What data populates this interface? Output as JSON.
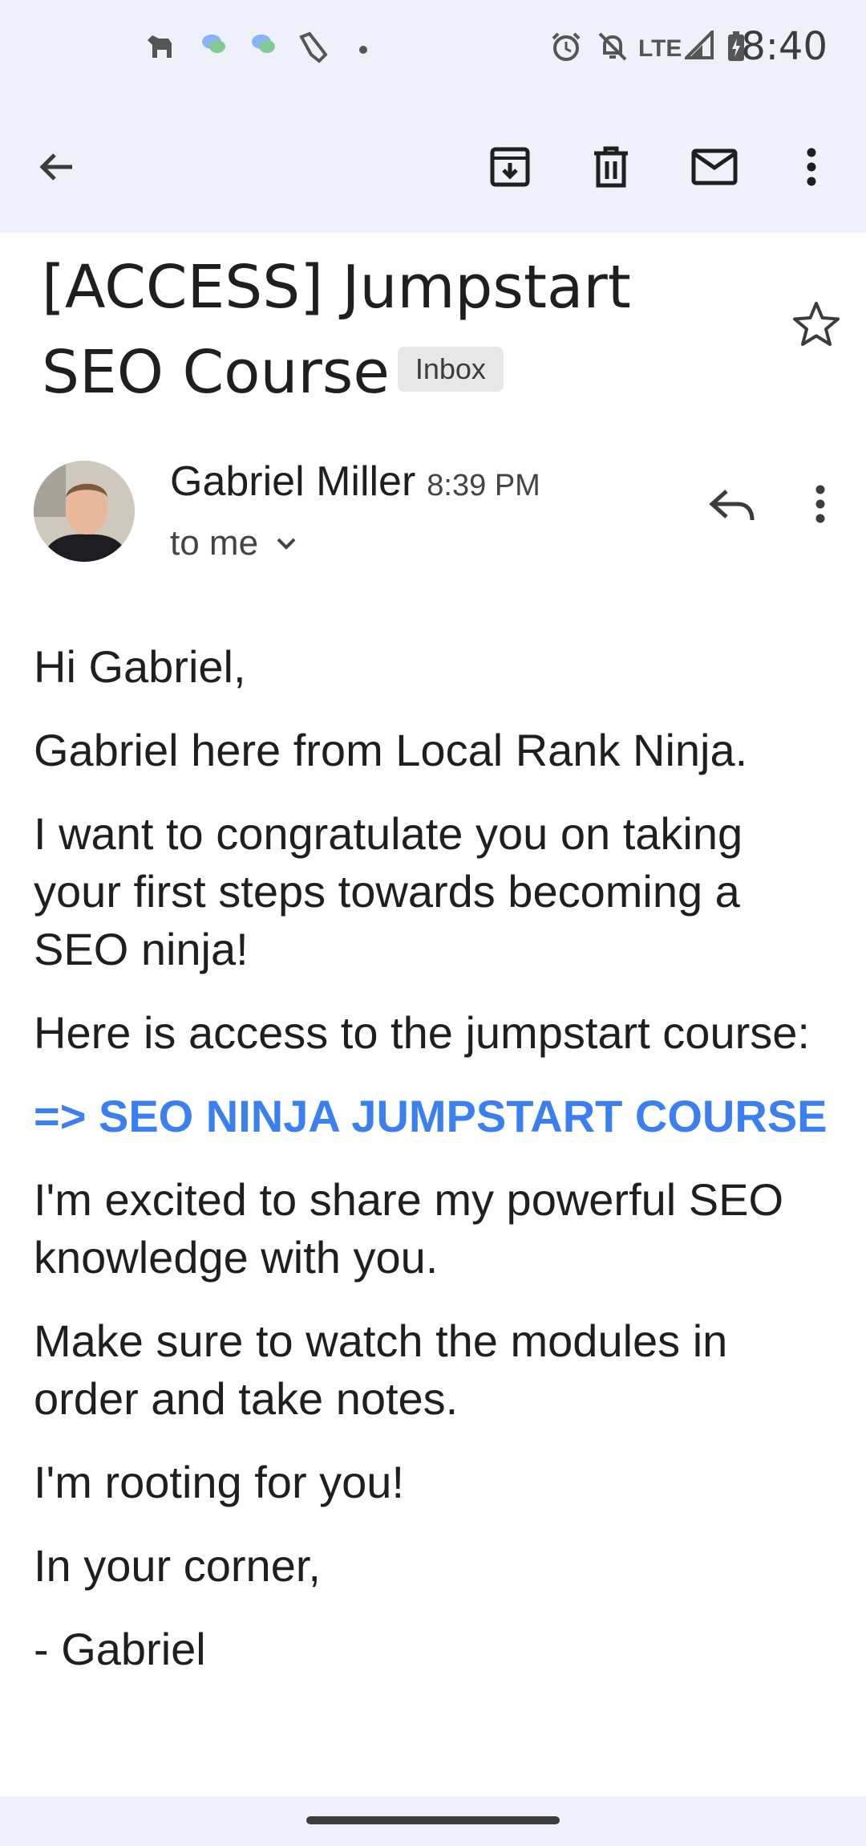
{
  "status_bar": {
    "time": "8:40",
    "network": "LTE",
    "icons": [
      "pets-icon",
      "chat-bubble-icon",
      "chat-bubble-icon",
      "broom-icon",
      "dot-icon",
      "alarm-icon",
      "bell-off-icon",
      "signal-icon",
      "battery-icon"
    ]
  },
  "app_bar": {
    "icons": [
      "back-arrow-icon",
      "archive-icon",
      "delete-icon",
      "mark-unread-icon",
      "more-vert-icon"
    ]
  },
  "email": {
    "subject": "[ACCESS] Jumpstart SEO Course",
    "label": "Inbox",
    "sender_name": "Gabriel Miller",
    "time": "8:39 PM",
    "recipient": "to me",
    "body": {
      "greeting": "Hi Gabriel,",
      "p1": "Gabriel here from Local Rank Ninja.",
      "p2": "I want to congratulate you on taking your first steps towards becoming a SEO ninja!",
      "p3": "Here is access to the jumpstart course:",
      "link": "=> SEO NINJA JUMPSTART COURSE",
      "p4": "I'm excited to share my powerful SEO knowledge with you.",
      "p5": "Make sure to watch the modules in order and take notes.",
      "p6": "I'm rooting for you!",
      "closing": "In your corner,",
      "signature": "- Gabriel"
    }
  },
  "colors": {
    "accent_link": "#3c7ff0",
    "top_bar_bg": "#eef1f9"
  }
}
